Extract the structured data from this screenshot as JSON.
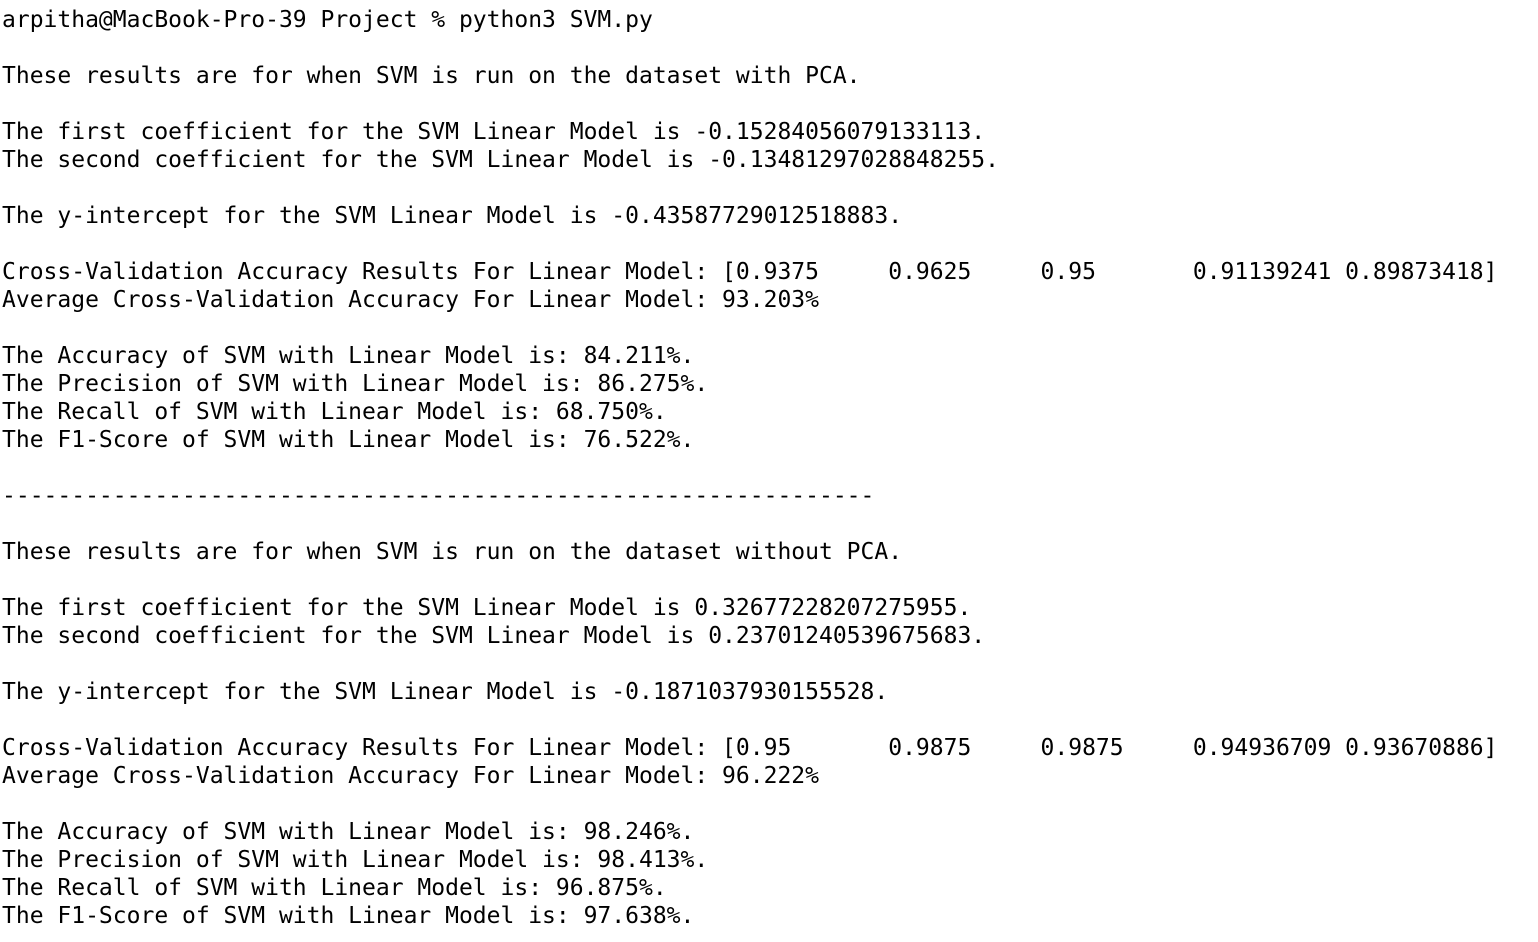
{
  "terminal": {
    "prompt": "arpitha@MacBook-Pro-39 Project % python3 SVM.py",
    "with_pca": {
      "header": "These results are for when SVM is run on the dataset with PCA.",
      "coef1": "The first coefficient for the SVM Linear Model is -0.15284056079133113.",
      "coef2": "The second coefficient for the SVM Linear Model is -0.13481297028848255.",
      "intercept": "The y-intercept for the SVM Linear Model is -0.43587729012518883.",
      "cv_results": "Cross-Validation Accuracy Results For Linear Model: [0.9375     0.9625     0.95       0.91139241 0.89873418]",
      "cv_average": "Average Cross-Validation Accuracy For Linear Model: 93.203%",
      "accuracy": "The Accuracy of SVM with Linear Model is: 84.211%.",
      "precision": "The Precision of SVM with Linear Model is: 86.275%.",
      "recall": "The Recall of SVM with Linear Model is: 68.750%.",
      "f1": "The F1-Score of SVM with Linear Model is: 76.522%."
    },
    "separator": "---------------------------------------------------------------",
    "without_pca": {
      "header": "These results are for when SVM is run on the dataset without PCA.",
      "coef1": "The first coefficient for the SVM Linear Model is 0.32677228207275955.",
      "coef2": "The second coefficient for the SVM Linear Model is 0.23701240539675683.",
      "intercept": "The y-intercept for the SVM Linear Model is -0.1871037930155528.",
      "cv_results": "Cross-Validation Accuracy Results For Linear Model: [0.95       0.9875     0.9875     0.94936709 0.93670886]",
      "cv_average": "Average Cross-Validation Accuracy For Linear Model: 96.222%",
      "accuracy": "The Accuracy of SVM with Linear Model is: 98.246%.",
      "precision": "The Precision of SVM with Linear Model is: 98.413%.",
      "recall": "The Recall of SVM with Linear Model is: 96.875%.",
      "f1": "The F1-Score of SVM with Linear Model is: 97.638%."
    }
  }
}
